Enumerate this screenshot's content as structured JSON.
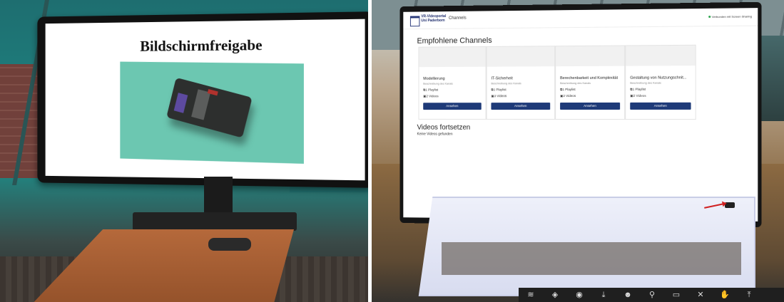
{
  "left_view": {
    "screen_title": "Bildschirmfreigabe"
  },
  "right_view": {
    "portal": {
      "logo_line1": "VR-Videoportal",
      "logo_line2": "Uni Paderborn",
      "nav_label": "Channels",
      "connection_status": "Verbunden mit Screen Sharing",
      "status_color": "#2ea44f"
    },
    "section_recommended": "Empfohlene Channels",
    "channels": [
      {
        "title": "Modellierung",
        "description": "Beschreibung des Kanals",
        "playlists": "1 Playlist",
        "videos": "2 Videos",
        "button": "Ansehen"
      },
      {
        "title": "IT-Sicherheit",
        "description": "Beschreibung des Kanals",
        "playlists": "1 Playlist",
        "videos": "3 Videos",
        "button": "Ansehen"
      },
      {
        "title": "Berechenbarkeit und Komplexität",
        "description": "Beschreibung des Kanals",
        "playlists": "1 Playlist",
        "videos": "2 Videos",
        "button": "Ansehen"
      },
      {
        "title": "Gestaltung von Nutzungschnit...",
        "description": "Beschreibung des Kanals",
        "playlists": "1 Playlist",
        "videos": "2 Videos",
        "button": "Ansehen"
      }
    ],
    "section_continue": "Videos fortsetzen",
    "continue_empty": "Keine Videos gefunden",
    "accent_color": "#1e3a78",
    "taskbar_icons": [
      "wifi-icon",
      "shield-icon",
      "camera-icon",
      "download-icon",
      "people-icon",
      "pin-icon",
      "window-icon",
      "close-icon",
      "hand-icon",
      "upload-icon",
      "share-icon"
    ]
  }
}
